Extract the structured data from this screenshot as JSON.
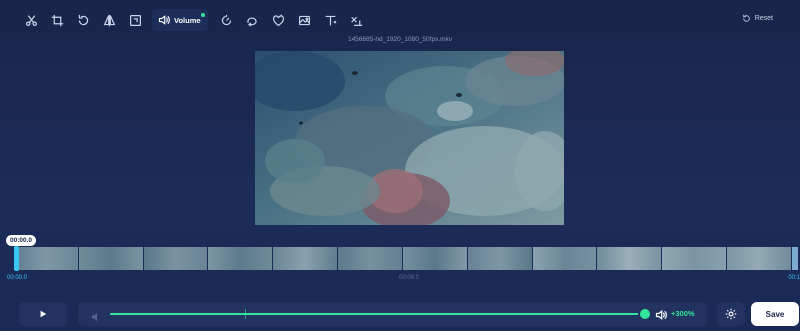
{
  "toolbar": {
    "tools": [
      {
        "name": "cut-tool",
        "icon": "scissors-icon"
      },
      {
        "name": "crop-tool",
        "icon": "crop-icon"
      },
      {
        "name": "rotate-tool",
        "icon": "rotate-icon"
      },
      {
        "name": "flip-tool",
        "icon": "flip-icon"
      },
      {
        "name": "frame-tool",
        "icon": "frame-icon"
      },
      {
        "name": "volume-tool",
        "icon": "speaker-icon",
        "label": "Volume",
        "active": true
      },
      {
        "name": "speed-tool",
        "icon": "speed-icon"
      },
      {
        "name": "loop-tool",
        "icon": "loop-icon"
      },
      {
        "name": "filter-tool",
        "icon": "filter-icon"
      },
      {
        "name": "image-tool",
        "icon": "image-icon"
      },
      {
        "name": "text-tool",
        "icon": "text-icon"
      },
      {
        "name": "remove-tool",
        "icon": "remove-icon"
      }
    ],
    "volume_label": "Volume",
    "reset_label": "Reset"
  },
  "file": {
    "name": "1456685-hd_1920_1080_50fps.mkv"
  },
  "timeline": {
    "current_time": "00:00.0",
    "start_label": "00:00.0",
    "mid_label": "00:08.0",
    "end_label": "00:1"
  },
  "volume": {
    "percent_label": "+300%",
    "level_fraction": 0.99,
    "baseline_fraction": 0.25
  },
  "actions": {
    "save_label": "Save"
  },
  "colors": {
    "accent": "#31e59c",
    "timeline_accent": "#37c6f4",
    "background": "#1c2b57"
  }
}
